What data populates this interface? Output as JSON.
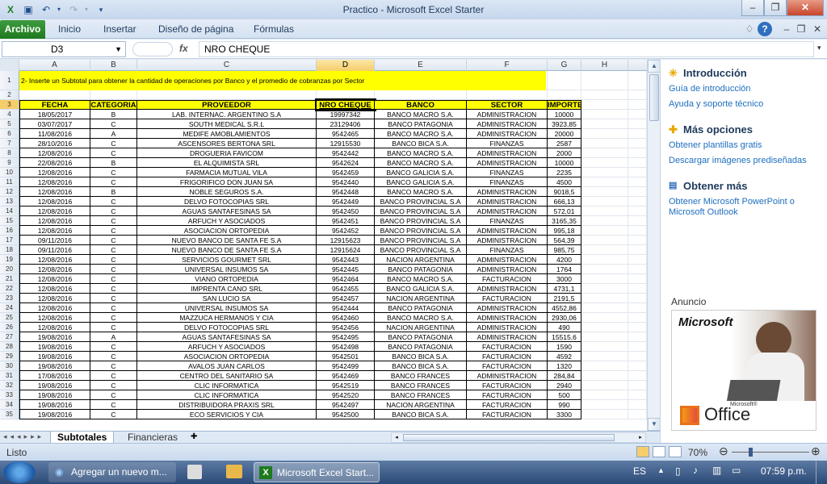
{
  "window": {
    "title": "Practico  -  Microsoft Excel Starter"
  },
  "ribbon": {
    "tabs": [
      "Archivo",
      "Inicio",
      "Insertar",
      "Diseño de página",
      "Fórmulas"
    ]
  },
  "formula_bar": {
    "name_box": "D3",
    "fx_label": "fx",
    "content": "NRO CHEQUE"
  },
  "columns": [
    "A",
    "B",
    "C",
    "D",
    "E",
    "F",
    "G",
    "H"
  ],
  "instruction_text": "2- Inserte un Subtotal para obtener la cantidad de operaciones por Banco y el promedio de cobranzas por Sector",
  "table_headers": [
    "FECHA",
    "CATEGORIA",
    "PROVEEDOR",
    "NRO CHEQUE",
    "BANCO",
    "SECTOR",
    "IMPORTE"
  ],
  "rows": [
    [
      "18/05/2017",
      "B",
      "LAB. INTERNAC. ARGENTINO S.A",
      "19997342",
      "BANCO MACRO S.A.",
      "ADMINISTRACION",
      "10000"
    ],
    [
      "03/07/2017",
      "C",
      "SOUTH MEDICAL S.R.L",
      "23129406",
      "BANCO PATAGONIA",
      "ADMINISTRACION",
      "3923,85"
    ],
    [
      "11/08/2016",
      "A",
      "MEDIFE AMOBLAMIENTOS",
      "9542465",
      "BANCO MACRO S.A.",
      "ADMINISTRACION",
      "20000"
    ],
    [
      "28/10/2016",
      "C",
      "ASCENSORES BERTONA SRL",
      "12915530",
      "BANCO BICA S.A.",
      "FINANZAS",
      "2587"
    ],
    [
      "12/08/2016",
      "C",
      "DROGUERIA FAVICOM",
      "9542442",
      "BANCO MACRO S.A.",
      "ADMINISTRACION",
      "2000"
    ],
    [
      "22/08/2016",
      "B",
      "EL ALQUIMISTA SRL",
      "9542624",
      "BANCO MACRO S.A.",
      "ADMINISTRACION",
      "10000"
    ],
    [
      "12/08/2016",
      "C",
      "FARMACIA MUTUAL VILA",
      "9542459",
      "BANCO GALICIA S.A.",
      "FINANZAS",
      "2235"
    ],
    [
      "12/08/2016",
      "C",
      "FRIGORIFICO DON JUAN SA",
      "9542440",
      "BANCO GALICIA S.A.",
      "FINANZAS",
      "4500"
    ],
    [
      "12/08/2016",
      "B",
      "NOBLE SEGUROS S.A.",
      "9542448",
      "BANCO MACRO S.A.",
      "ADMINISTRACION",
      "9018,5"
    ],
    [
      "12/08/2016",
      "C",
      "DELVO FOTOCOPIAS SRL",
      "9542449",
      "BANCO PROVINCIAL S.A",
      "ADMINISTRACION",
      "666,13"
    ],
    [
      "12/08/2016",
      "C",
      "AGUAS SANTAFESINAS SA",
      "9542450",
      "BANCO PROVINCIAL S.A",
      "ADMINISTRACION",
      "572,01"
    ],
    [
      "12/08/2016",
      "C",
      "ARFUCH Y ASOCIADOS",
      "9542451",
      "BANCO PROVINCIAL S.A",
      "FINANZAS",
      "3165,35"
    ],
    [
      "12/08/2016",
      "C",
      "ASOCIACION ORTOPEDIA",
      "9542452",
      "BANCO PROVINCIAL S.A",
      "ADMINISTRACION",
      "995,18"
    ],
    [
      "09/11/2016",
      "C",
      "NUEVO BANCO DE SANTA FE S.A",
      "12915623",
      "BANCO PROVINCIAL S.A",
      "ADMINISTRACION",
      "564,39"
    ],
    [
      "09/11/2016",
      "C",
      "NUEVO BANCO DE SANTA FE S.A",
      "12915624",
      "BANCO PROVINCIAL S.A",
      "FINANZAS",
      "985,75"
    ],
    [
      "12/08/2016",
      "C",
      "SERVICIOS GOURMET SRL",
      "9542443",
      "NACION ARGENTINA",
      "ADMINISTRACION",
      "4200"
    ],
    [
      "12/08/2016",
      "C",
      "UNIVERSAL INSUMOS SA",
      "9542445",
      "BANCO PATAGONIA",
      "ADMINISTRACION",
      "1764"
    ],
    [
      "12/08/2016",
      "C",
      "VIANO ORTOPEDIA",
      "9542464",
      "BANCO MACRO S.A.",
      "FACTURACION",
      "3000"
    ],
    [
      "12/08/2016",
      "C",
      "IMPRENTA CANO SRL",
      "9542455",
      "BANCO GALICIA S.A.",
      "ADMINISTRACION",
      "4731,1"
    ],
    [
      "12/08/2016",
      "C",
      "SAN LUCIO SA",
      "9542457",
      "NACION ARGENTINA",
      "FACTURACION",
      "2191,5"
    ],
    [
      "12/08/2016",
      "C",
      "UNIVERSAL INSUMOS SA",
      "9542444",
      "BANCO PATAGONIA",
      "ADMINISTRACION",
      "4552,86"
    ],
    [
      "12/08/2016",
      "C",
      "MAZZUCA HERMANOS Y CIA",
      "9542460",
      "BANCO MACRO S.A.",
      "ADMINISTRACION",
      "2930,06"
    ],
    [
      "12/08/2016",
      "C",
      "DELVO FOTOCOPIAS SRL",
      "9542456",
      "NACION ARGENTINA",
      "ADMINISTRACION",
      "490"
    ],
    [
      "19/08/2016",
      "A",
      "AGUAS SANTAFESINAS SA",
      "9542495",
      "BANCO PATAGONIA",
      "ADMINISTRACION",
      "15515,6"
    ],
    [
      "19/08/2016",
      "C",
      "ARFUCH Y ASOCIADOS",
      "9542498",
      "BANCO PATAGONIA",
      "FACTURACION",
      "1590"
    ],
    [
      "19/08/2016",
      "C",
      "ASOCIACION ORTOPEDIA",
      "9542501",
      "BANCO BICA S.A.",
      "FACTURACION",
      "4592"
    ],
    [
      "19/08/2016",
      "C",
      "AVALOS JUAN CARLOS",
      "9542499",
      "BANCO BICA S.A.",
      "FACTURACION",
      "1320"
    ],
    [
      "17/08/2016",
      "C",
      "CENTRO DEL SANITARIO SA",
      "9542469",
      "BANCO FRANCES",
      "ADMINISTRACION",
      "284,84"
    ],
    [
      "19/08/2016",
      "C",
      "CLIC INFORMATICA",
      "9542519",
      "BANCO FRANCES",
      "FACTURACION",
      "2940"
    ],
    [
      "19/08/2016",
      "C",
      "CLIC INFORMATICA",
      "9542520",
      "BANCO FRANCES",
      "FACTURACION",
      "500"
    ],
    [
      "19/08/2016",
      "C",
      "DISTRIBUIDORA PRAXIS SRL",
      "9542497",
      "NACION ARGENTINA",
      "FACTURACION",
      "990"
    ],
    [
      "19/08/2016",
      "C",
      "ECO SERVICIOS Y CIA",
      "9542500",
      "BANCO BICA S.A.",
      "FACTURACION",
      "3300"
    ]
  ],
  "sheet_tabs": [
    "Subtotales",
    "Financieras"
  ],
  "status": {
    "ready": "Listo",
    "zoom": "70%"
  },
  "pane": {
    "intro_title": "Introducción",
    "intro_links": [
      "Guía de introducción",
      "Ayuda y soporte técnico"
    ],
    "more_title": "Más opciones",
    "more_links": [
      "Obtener plantillas gratis",
      "Descargar imágenes prediseñadas"
    ],
    "get_title": "Obtener más",
    "get_links": [
      "Obtener Microsoft PowerPoint o Microsoft Outlook"
    ],
    "ad_label": "Anuncio",
    "ad_brand": "Microsoft",
    "ad_product": "Office",
    "ad_small": "Microsoft®"
  },
  "taskbar": {
    "items": [
      "Agregar un nuevo m...",
      "Microsoft Excel Start..."
    ],
    "lang": "ES",
    "clock": "07:59 p.m."
  }
}
